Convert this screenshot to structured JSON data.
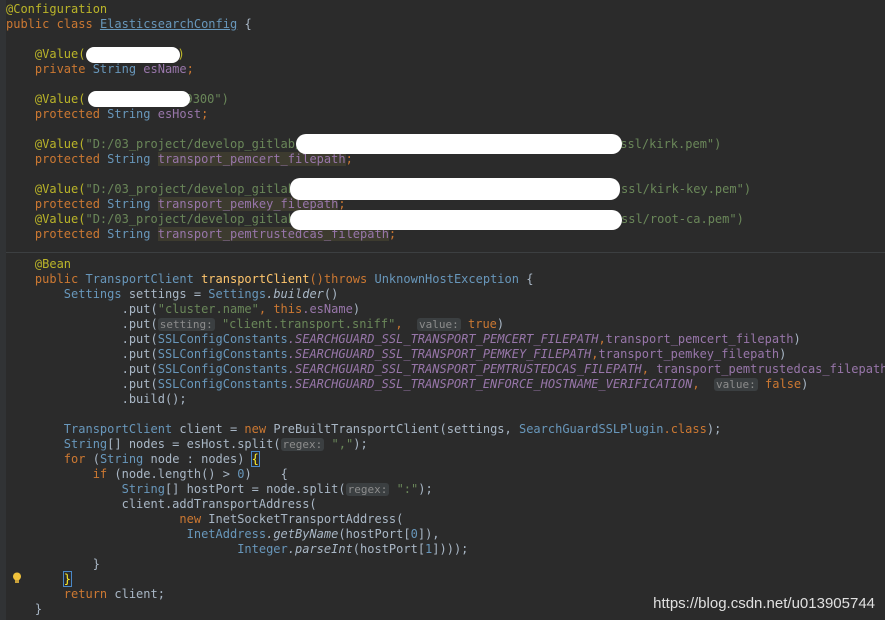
{
  "code": {
    "annotation_configuration": "@Configuration",
    "class_decl_public": "public ",
    "class_decl_class": "class ",
    "class_name": "ElasticsearchConfig",
    "class_brace": " {",
    "value_ann_1": "@Value(",
    "value_ann_1_end": ")",
    "private_kw": "private ",
    "string_type": "String ",
    "es_name": "esName",
    "semicolon": ";",
    "value_ann_2": "@Value(",
    "value_ann_2_tail": "9300\")",
    "protected_kw": "protected ",
    "es_host": "esHost",
    "value_ann_3": "@Value(",
    "path_prefix": "\"D:/03_project/develop_gitlab/",
    "pem_suffix": "ssl/kirk.pem\")",
    "field_pemcert": "transport_pemcert_filepath",
    "path_prefix_short": "\"D:/03_project/develop_gitlab",
    "key_suffix": "ssl/kirk-key.pem\")",
    "field_pemkey": "transport_pemkey_filepath",
    "ca_suffix": "ssl/root-ca.pem\")",
    "field_pemtrusted": "transport_pemtrustedcas_filepath",
    "bean_ann": "@Bean",
    "public_kw": "public ",
    "transport_client_type": "TransportClient",
    "method_name": " transportClient",
    "method_sig_tail": "()throws ",
    "unknown_host_ex": "UnknownHostException",
    "open_brace": " {",
    "settings_type": "Settings",
    "settings_var": " settings = ",
    "settings_builder_cls": "Settings",
    "builder_call": ".builder",
    "parens": "()",
    "put_open": ".put(",
    "cluster_name_str": "\"cluster.name\"",
    "comma_sp": ", ",
    "this_kw": "this",
    "dot_esname": ".esName",
    "close_paren": ")",
    "hint_setting": "setting:",
    "sniff_str": "\"client.transport.sniff\"",
    "hint_value": "value:",
    "true_kw": "true",
    "ssl_consts_cls": "SSLConfigConstants",
    "const_pemcert": ".SEARCHGUARD_SSL_TRANSPORT_PEMCERT_FILEPATH",
    "const_pemkey": ".SEARCHGUARD_SSL_TRANSPORT_PEMKEY_FILEPATH",
    "const_pemtrusted": ".SEARCHGUARD_SSL_TRANSPORT_PEMTRUSTEDCAS_FILEPATH",
    "const_enforce": ".SEARCHGUARD_SSL_TRANSPORT_ENFORCE_HOSTNAME_VERIFICATION",
    "comma": ",",
    "false_kw": "false",
    "build_call": ".build();",
    "client_var": " client = ",
    "new_kw": "new ",
    "prebuilt_cls": "PreBuiltTransportClient",
    "settings_arg": "(settings, ",
    "sg_plugin_cls": "SearchGuardSSLPlugin",
    "dot_class": ".class",
    "close_stmt": ");",
    "string_arr_type": "String",
    "nodes_decl": "[] nodes = esHost.split(",
    "hint_regex": "regex:",
    "comma_str": "\",\"",
    "for_kw": "for ",
    "for_open": "(",
    "node_decl": "node : nodes) ",
    "brace_open_hl": "{",
    "if_kw": "if ",
    "if_cond": "(node.length() > ",
    "zero": "0",
    "if_close": ")    {",
    "hostport_decl": "[] hostPort = node.split(",
    "colon_str": "\":\"",
    "add_transport": "client.addTransportAddress(",
    "inet_socket_cls": "InetSocketTransportAddress",
    "inet_address_cls": "InetAddress",
    "get_by_name": ".getByName",
    "hostport0_open": "(hostPort[",
    "hostport_close": "]),",
    "integer_cls": "Integer",
    "parse_int": ".parseInt",
    "hostport1_open": "(hostPort[",
    "one": "1",
    "tail_close": "])));",
    "inner_brace": "}",
    "brace_hl_close": "}",
    "return_kw": "return ",
    "return_client": "client;",
    "outer_brace": "}"
  },
  "watermark": "https://blog.csdn.net/u013905744",
  "icons": {
    "bulb": "lightbulb-icon"
  }
}
